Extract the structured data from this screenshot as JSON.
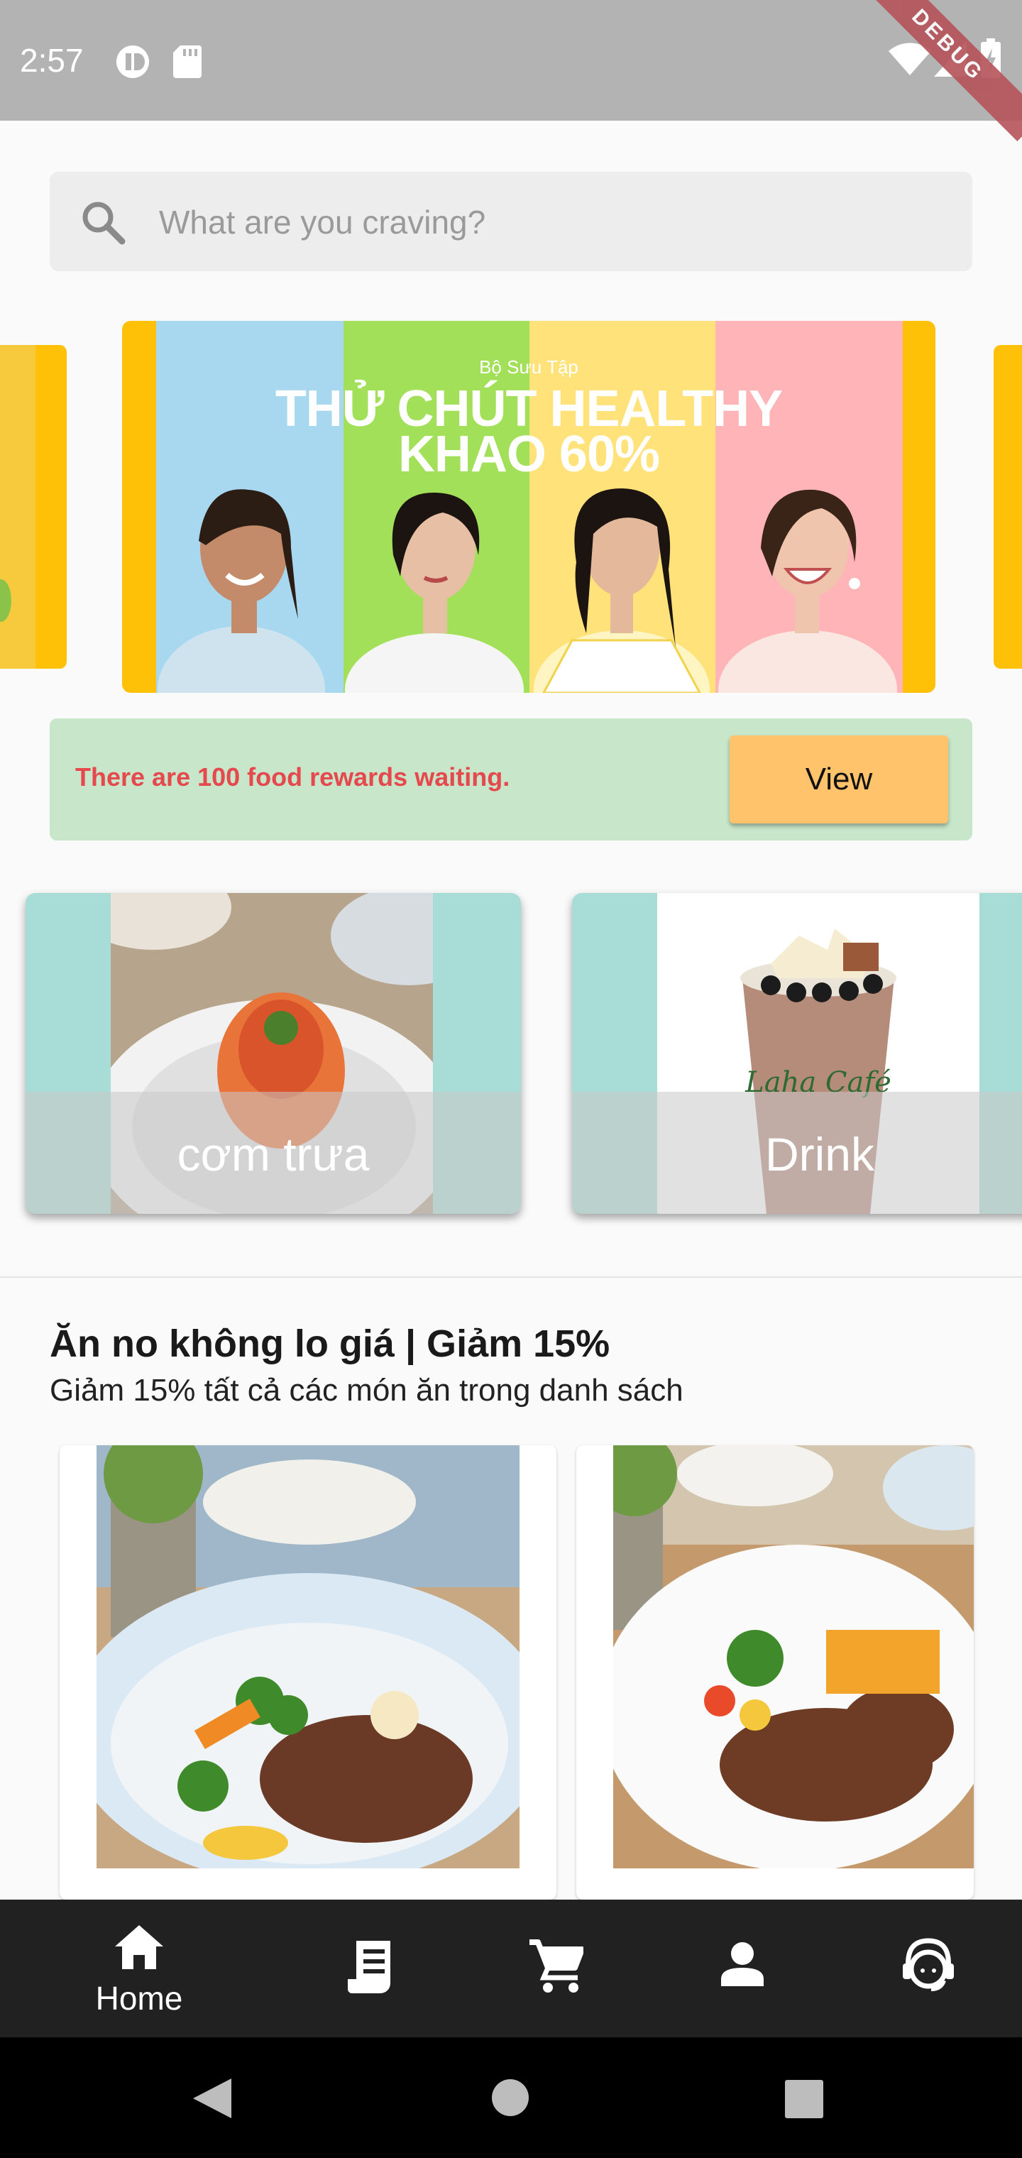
{
  "status_bar": {
    "time": "2:57",
    "debug_label": "DEBUG",
    "icons": [
      "pause-circle-icon",
      "sd-card-icon",
      "wifi-icon",
      "signal-icon",
      "battery-charging-icon"
    ]
  },
  "search": {
    "placeholder": "What are you craving?",
    "icon": "search-icon"
  },
  "banner": {
    "kicker": "Bộ Sưu Tập",
    "headline_line1": "THỬ CHÚT HEALTHY",
    "headline_line2": "KHAO 60%",
    "colors": [
      "#ffc107",
      "#a8d8f0",
      "#a3e05a",
      "#ffe27a",
      "#ffb5b8"
    ]
  },
  "rewards": {
    "text": "There are 100 food rewards waiting.",
    "button": "View"
  },
  "categories": [
    {
      "label": "cơm trưa"
    },
    {
      "label": "Drink"
    }
  ],
  "section": {
    "title": "Ăn no không lo giá | Giảm 15%",
    "subtitle": "Giảm 15% tất cả các món ăn trong danh sách"
  },
  "bottom_nav": [
    {
      "label": "Home",
      "icon": "home-icon",
      "active": true
    },
    {
      "label": "",
      "icon": "receipt-icon",
      "active": false
    },
    {
      "label": "",
      "icon": "cart-icon",
      "active": false
    },
    {
      "label": "",
      "icon": "person-icon",
      "active": false
    },
    {
      "label": "",
      "icon": "support-agent-icon",
      "active": false
    }
  ],
  "system_nav": [
    "back-icon",
    "home-circle-icon",
    "recents-icon"
  ]
}
